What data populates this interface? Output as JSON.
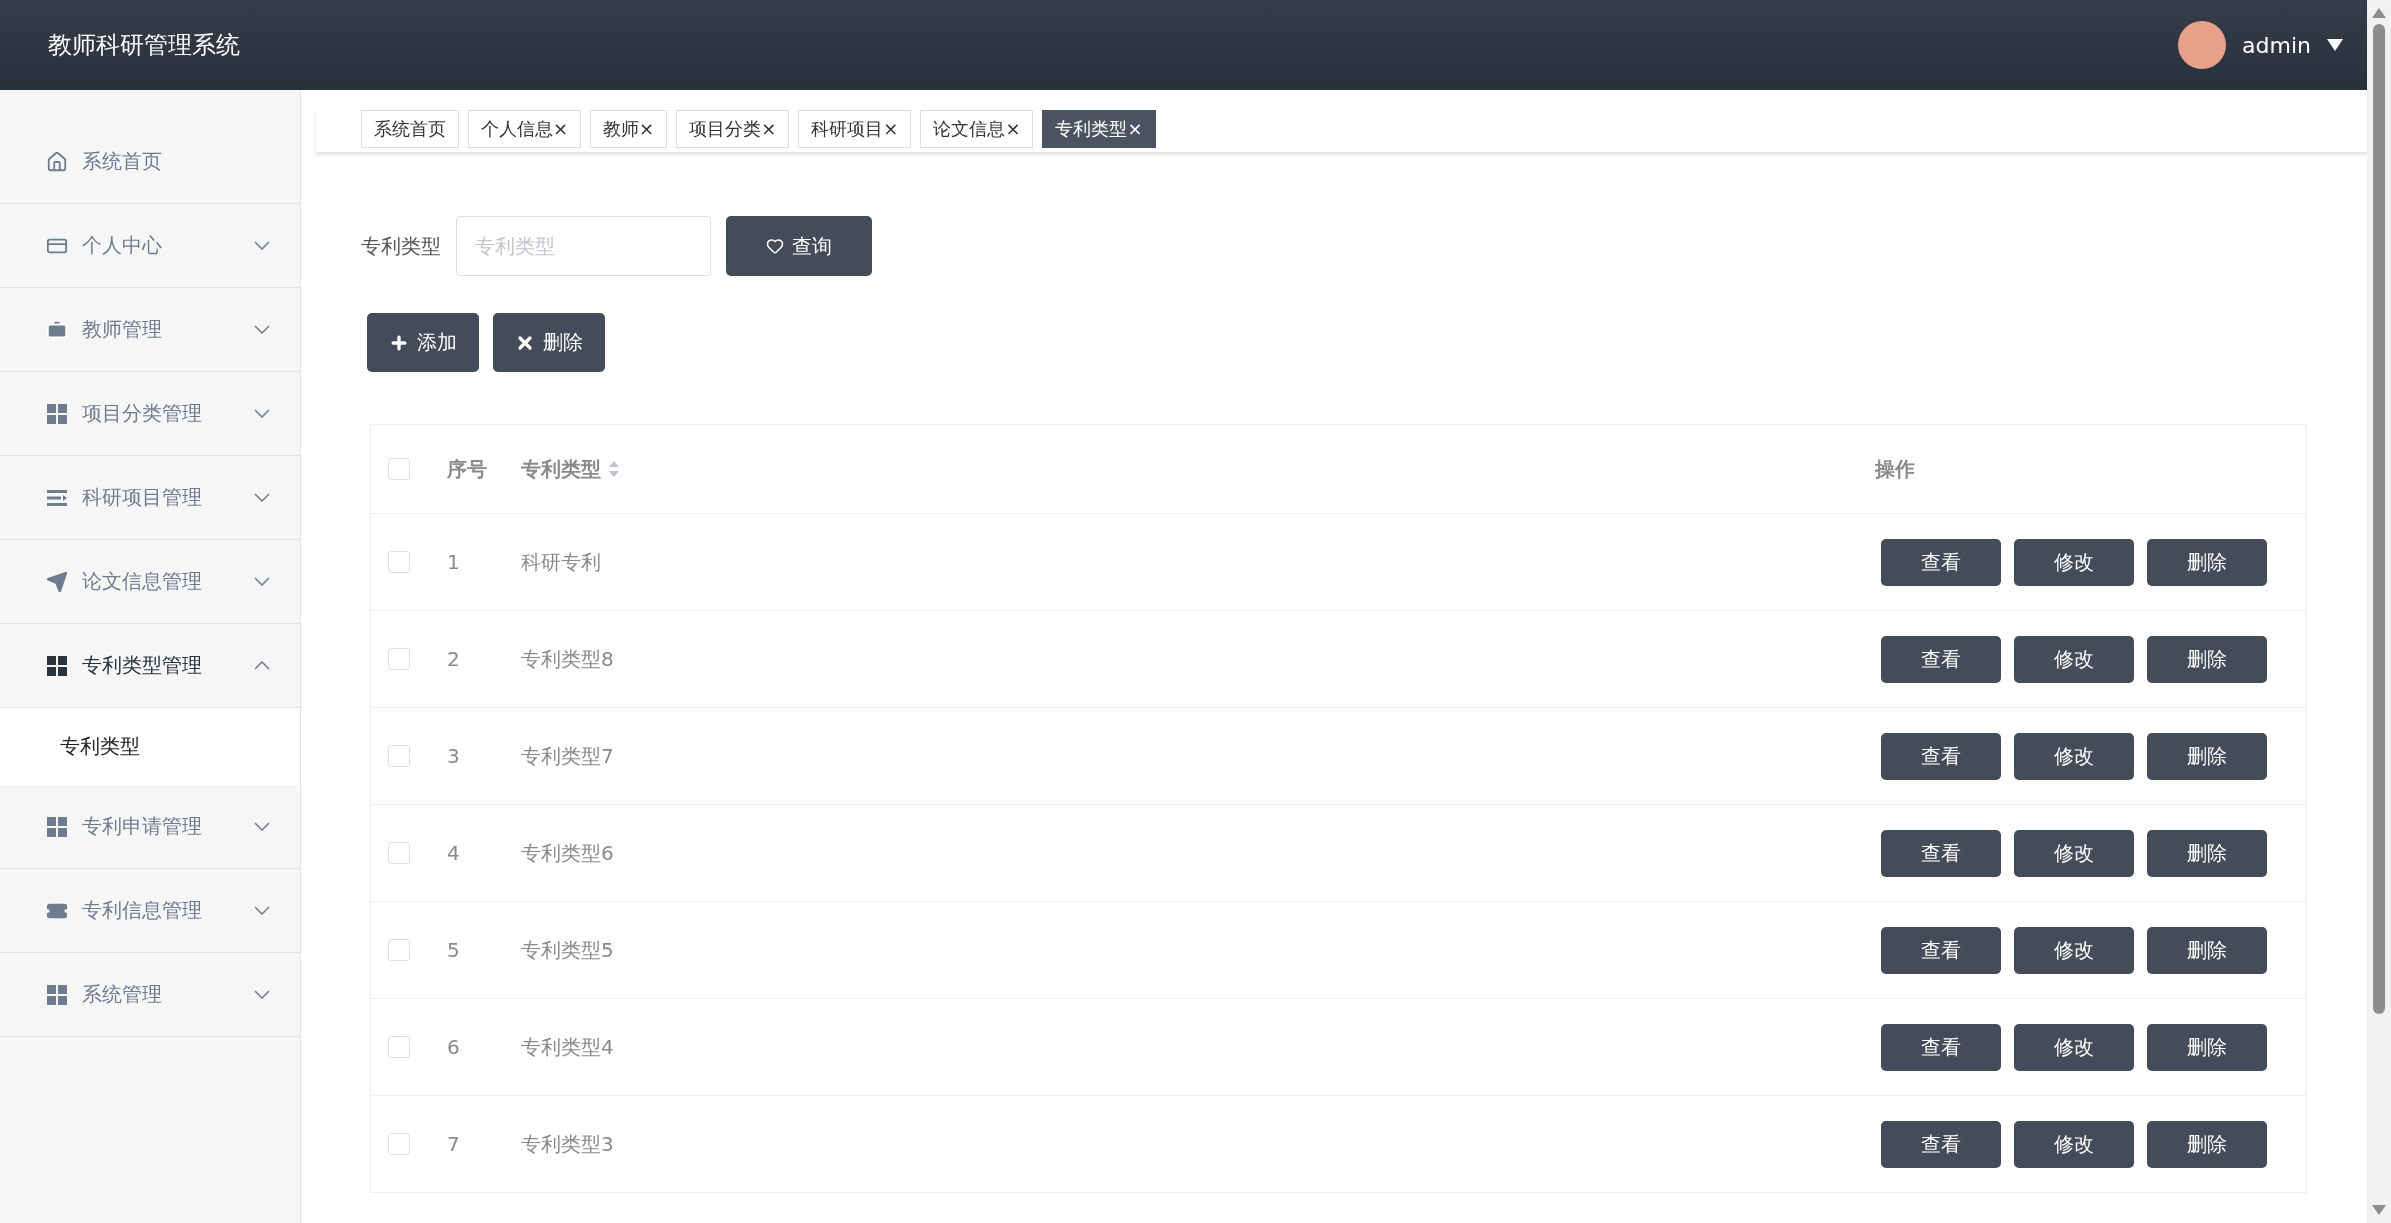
{
  "header": {
    "title": "教师科研管理系统",
    "user": "admin"
  },
  "sidebar": {
    "items": [
      {
        "label": "系统首页",
        "expanded": false
      },
      {
        "label": "个人中心",
        "expanded": false
      },
      {
        "label": "教师管理",
        "expanded": false
      },
      {
        "label": "项目分类管理",
        "expanded": false
      },
      {
        "label": "科研项目管理",
        "expanded": false
      },
      {
        "label": "论文信息管理",
        "expanded": false
      },
      {
        "label": "专利类型管理",
        "expanded": true,
        "children": [
          {
            "label": "专利类型",
            "selected": true
          }
        ]
      },
      {
        "label": "专利申请管理",
        "expanded": false
      },
      {
        "label": "专利信息管理",
        "expanded": false
      },
      {
        "label": "系统管理",
        "expanded": false
      }
    ]
  },
  "tabs": [
    {
      "label": "系统首页",
      "selected": false
    },
    {
      "label": "个人信息",
      "close": "×",
      "selected": false
    },
    {
      "label": "教师",
      "close": "×",
      "selected": false
    },
    {
      "label": "项目分类",
      "close": "×",
      "selected": false
    },
    {
      "label": "科研项目",
      "close": "×",
      "selected": false
    },
    {
      "label": "论文信息",
      "close": "×",
      "selected": false
    },
    {
      "label": "专利类型",
      "close": "×",
      "selected": true
    }
  ],
  "search": {
    "label": "专利类型",
    "placeholder": "专利类型",
    "button": "查询"
  },
  "actions": [
    "添加",
    "删除"
  ],
  "table": {
    "columns": [
      "序号",
      "专利类型",
      "操作"
    ],
    "header_checked": false,
    "rows": [
      {
        "index": "1",
        "name": "科研专利",
        "checked": false,
        "buttons": [
          "查看",
          "修改",
          "删除"
        ]
      },
      {
        "index": "2",
        "name": "专利类型8",
        "checked": false,
        "buttons": [
          "查看",
          "修改",
          "删除"
        ]
      },
      {
        "index": "3",
        "name": "专利类型7",
        "checked": false,
        "buttons": [
          "查看",
          "修改",
          "删除"
        ]
      },
      {
        "index": "4",
        "name": "专利类型6",
        "checked": false,
        "buttons": [
          "查看",
          "修改",
          "删除"
        ]
      },
      {
        "index": "5",
        "name": "专利类型5",
        "checked": false,
        "buttons": [
          "查看",
          "修改",
          "删除"
        ]
      },
      {
        "index": "6",
        "name": "专利类型4",
        "checked": false,
        "buttons": [
          "查看",
          "修改",
          "删除"
        ]
      },
      {
        "index": "7",
        "name": "专利类型3",
        "checked": false,
        "buttons": [
          "查看",
          "修改",
          "删除"
        ]
      }
    ]
  }
}
